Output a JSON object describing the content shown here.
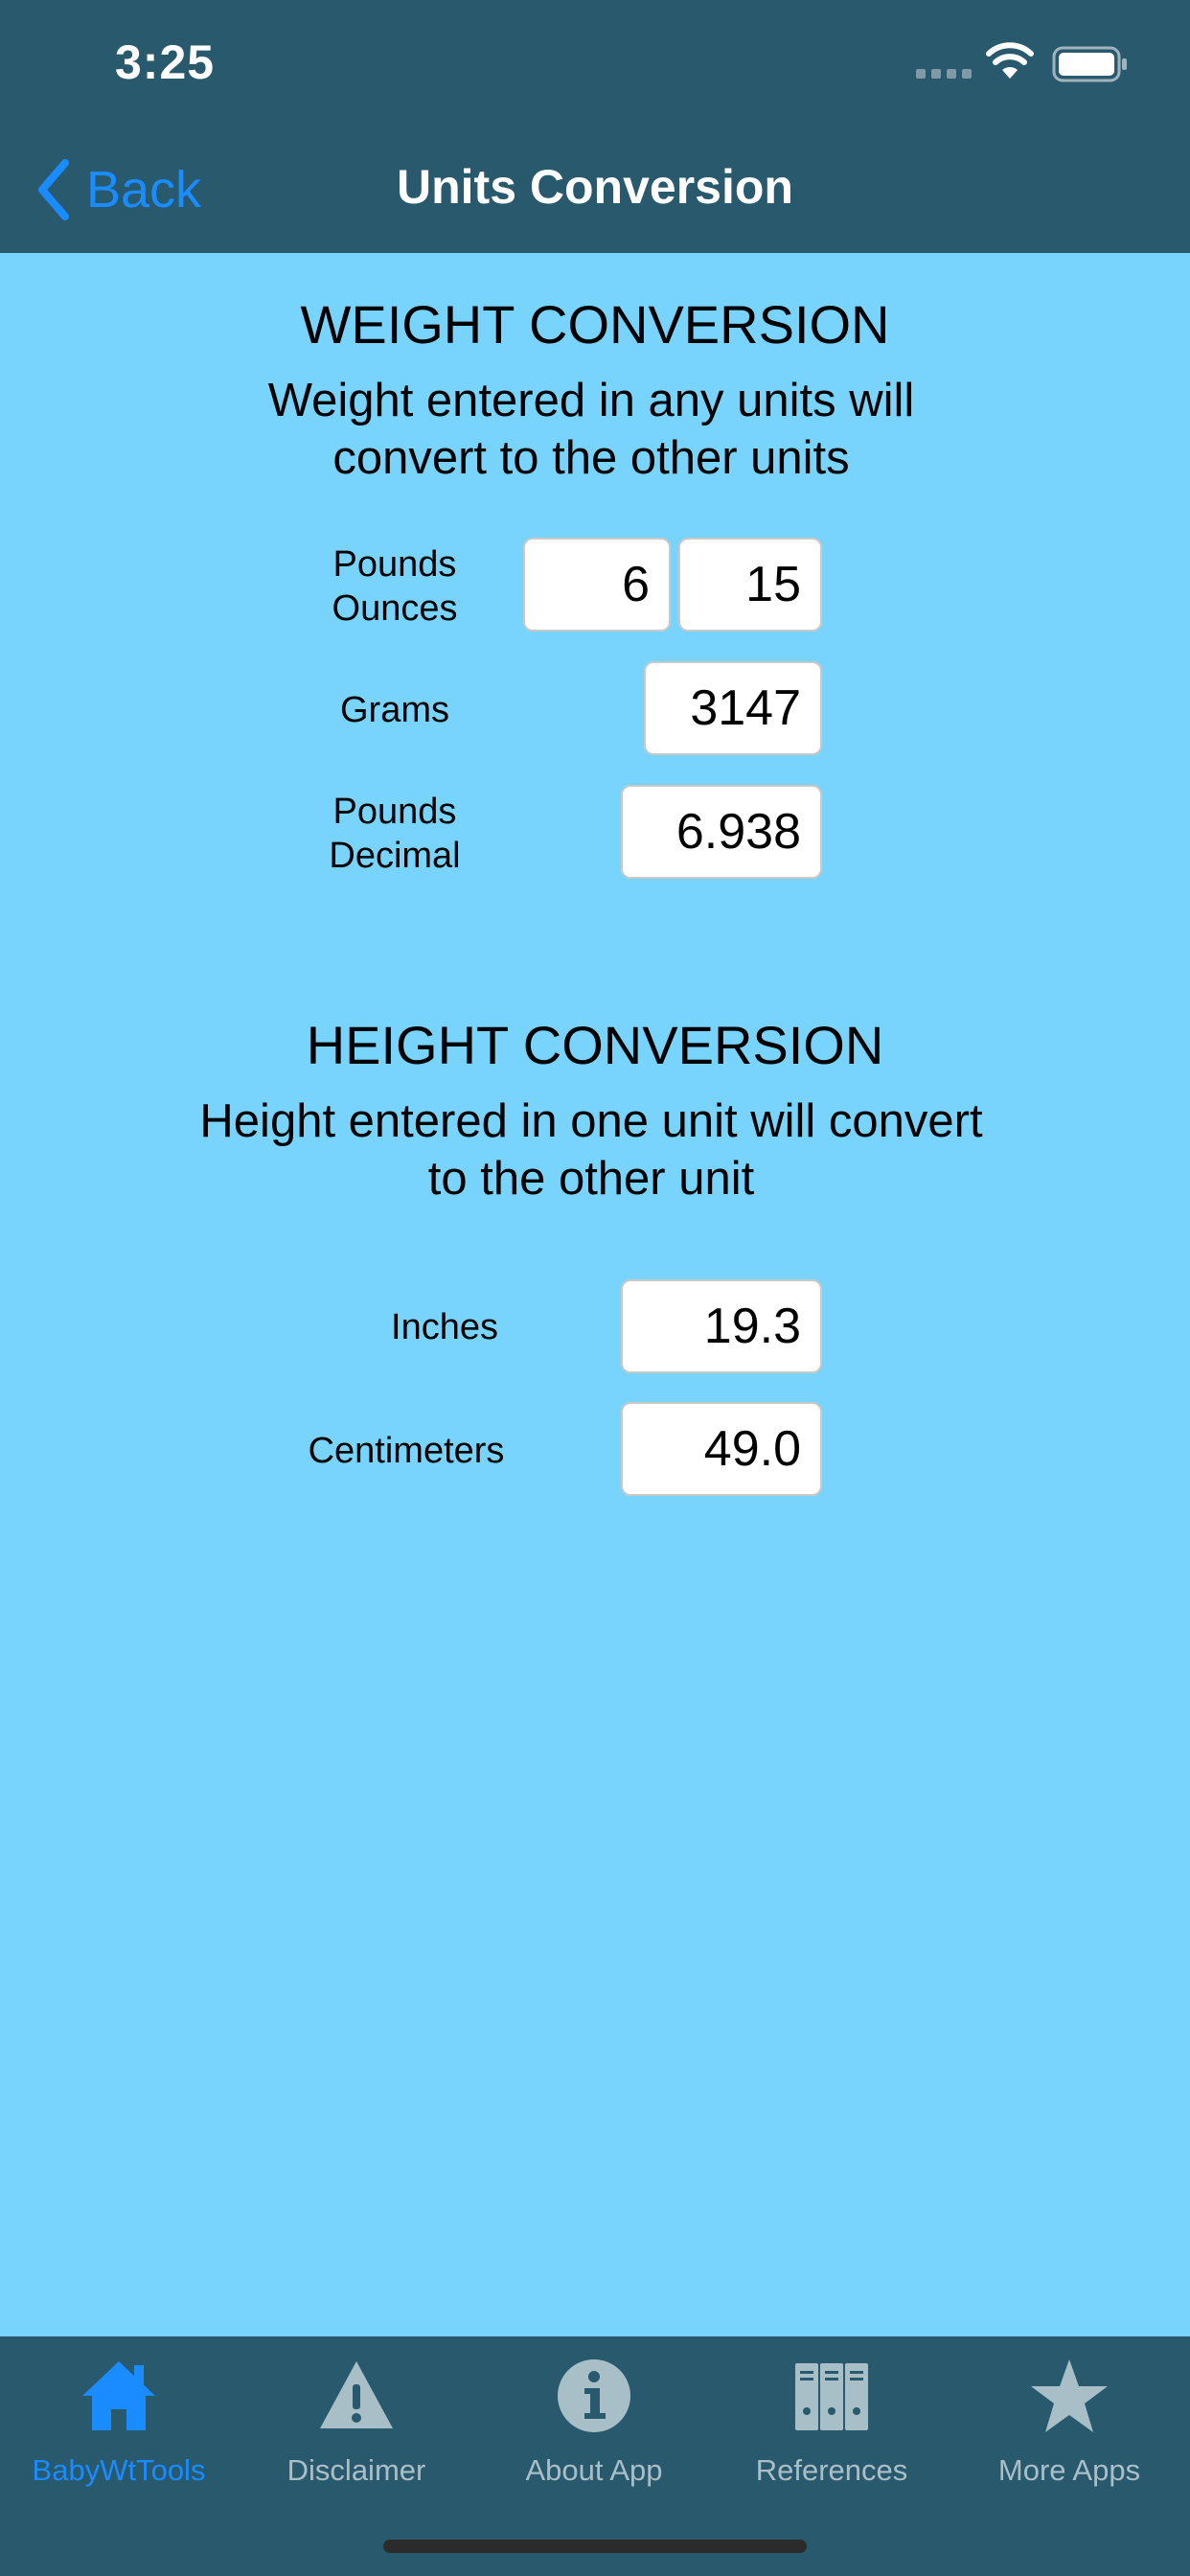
{
  "status_bar": {
    "time": "3:25"
  },
  "nav": {
    "back_label": "Back",
    "title": "Units Conversion"
  },
  "weight": {
    "title": "WEIGHT CONVERSION",
    "description": "Weight entered in any units will convert to the other units",
    "pounds_ounces_label_line1": "Pounds",
    "pounds_ounces_label_line2": "Ounces",
    "pounds_value": "6",
    "ounces_value": "15",
    "grams_label": "Grams",
    "grams_value": "3147",
    "pounds_decimal_label_line1": "Pounds",
    "pounds_decimal_label_line2": "Decimal",
    "pounds_decimal_value": "6.938"
  },
  "height": {
    "title": "HEIGHT CONVERSION",
    "description": "Height entered in one unit will convert to the other unit",
    "inches_label": "Inches",
    "inches_value": "19.3",
    "centimeters_label": "Centimeters",
    "centimeters_value": "49.0"
  },
  "tabbar": {
    "tabs": [
      {
        "label": "BabyWtTools",
        "icon": "home-icon",
        "active": true
      },
      {
        "label": "Disclaimer",
        "icon": "warning-icon",
        "active": false
      },
      {
        "label": "About App",
        "icon": "info-icon",
        "active": false
      },
      {
        "label": "References",
        "icon": "binders-icon",
        "active": false
      },
      {
        "label": "More Apps",
        "icon": "star-icon",
        "active": false
      }
    ]
  },
  "colors": {
    "background": "#78d4fd",
    "bar": "#28596d",
    "accent": "#1a8cff",
    "inactive_tab": "#a9bfc8"
  }
}
